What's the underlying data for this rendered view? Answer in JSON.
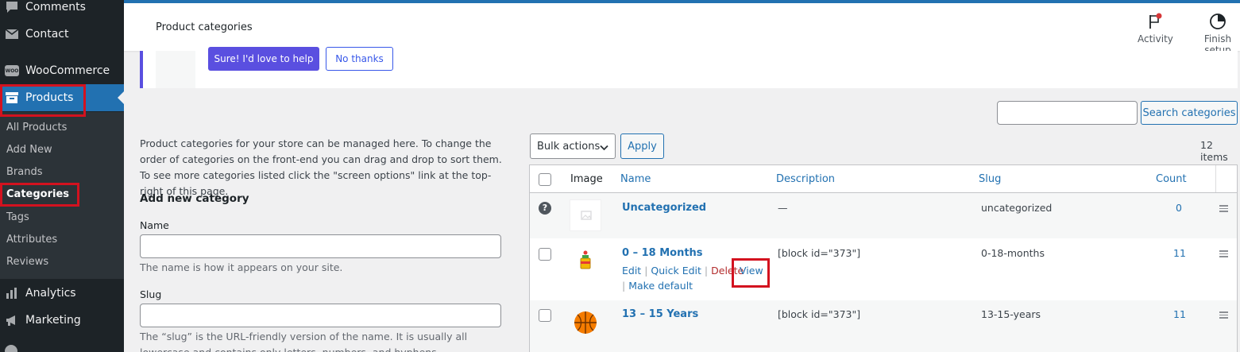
{
  "sidebar": {
    "comments": "Comments",
    "contact": "Contact",
    "woocommerce": "WooCommerce",
    "woo_badge": "WOO",
    "products": "Products",
    "submenu": [
      "All Products",
      "Add New",
      "Brands",
      "Categories",
      "Tags",
      "Attributes",
      "Reviews"
    ],
    "analytics": "Analytics",
    "marketing": "Marketing"
  },
  "header": {
    "title": "Product categories",
    "activity": "Activity",
    "finish_setup": "Finish setup"
  },
  "notice": {
    "yes_label": "Sure! I'd love to help",
    "no_label": "No thanks"
  },
  "search": {
    "button": "Search categories"
  },
  "form": {
    "intro": "Product categories for your store can be managed here. To change the order of categories on the front-end you can drag and drop to sort them. To see more categories listed click the \"screen options\" link at the top-right of this page.",
    "heading": "Add new category",
    "name_label": "Name",
    "name_help": "The name is how it appears on your site.",
    "slug_label": "Slug",
    "slug_help": "The “slug” is the URL-friendly version of the name. It is usually all lowercase and contains only letters, numbers, and hyphens."
  },
  "table": {
    "bulk_actions": "Bulk actions",
    "apply": "Apply",
    "items_count": "12 items",
    "columns": [
      "Image",
      "Name",
      "Description",
      "Slug",
      "Count"
    ],
    "rows": [
      {
        "name": "Uncategorized",
        "description": "—",
        "slug": "uncategorized",
        "count": "0"
      },
      {
        "name": "0 – 18 Months",
        "description": "[block id=\"373\"]",
        "slug": "0-18-months",
        "count": "11"
      },
      {
        "name": "13 – 15 Years",
        "description": "[block id=\"373\"]",
        "slug": "13-15-years",
        "count": "11"
      }
    ],
    "row_actions": {
      "edit": "Edit",
      "quick_edit": "Quick Edit",
      "delete": "Delete",
      "view": "View",
      "make_default": "Make default",
      "separator": "|"
    }
  },
  "colors": {
    "admin_bg": "#1d2327",
    "accent": "#2271b1",
    "woo_purple": "#5a4fe0",
    "highlight_red": "#d3121f"
  }
}
